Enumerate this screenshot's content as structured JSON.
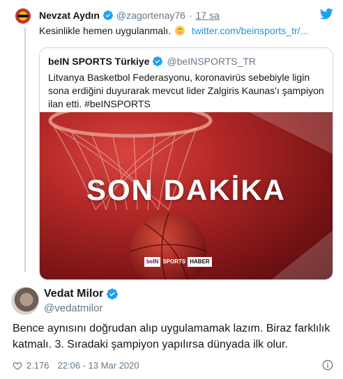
{
  "parent_tweet": {
    "author_name": "Nevzat Aydın",
    "author_handle": "@zagortenay76",
    "separator": "·",
    "time": "17 sa",
    "text": "Kesinlikle hemen uygulanmalı.",
    "emoji": "relieved-face-emoji",
    "link": "twitter.com/beinsports_tr/..."
  },
  "quoted_tweet": {
    "author_name": "beIN SPORTS Türkiye",
    "author_handle": "@beINSPORTS_TR",
    "text": "Litvanya Basketbol Federasyonu, koronavirüs sebebiyle ligin sona erdiğini duyurarak mevcut lider Zalgiris Kaunas'ı şampiyon ilan etti. #beINSPORTS",
    "media": {
      "headline": "SON DAKİKA",
      "brand_bein": "beIN",
      "brand_sports": "SPORTS",
      "brand_haber": "HABER"
    }
  },
  "reply_tweet": {
    "author_name": "Vedat Milor",
    "author_handle": "@vedatmilor",
    "text": "Bence aynısını doğrudan alıp uygulamamak lazım. Biraz farklılık katmalı. 3. Sıradaki şampiyon yapılırsa dünyada ilk olur.",
    "like_count": "2.176",
    "timestamp": "22:06 - 13 Mar 2020"
  },
  "colors": {
    "verified_blue": "#1da1f2",
    "link_blue": "#1b95e0",
    "muted_text": "#657786",
    "border": "#ccd6dd",
    "media_red": "#b62a28"
  },
  "icons": [
    "verified-badge-icon",
    "twitter-bird-icon",
    "heart-icon",
    "info-icon"
  ]
}
